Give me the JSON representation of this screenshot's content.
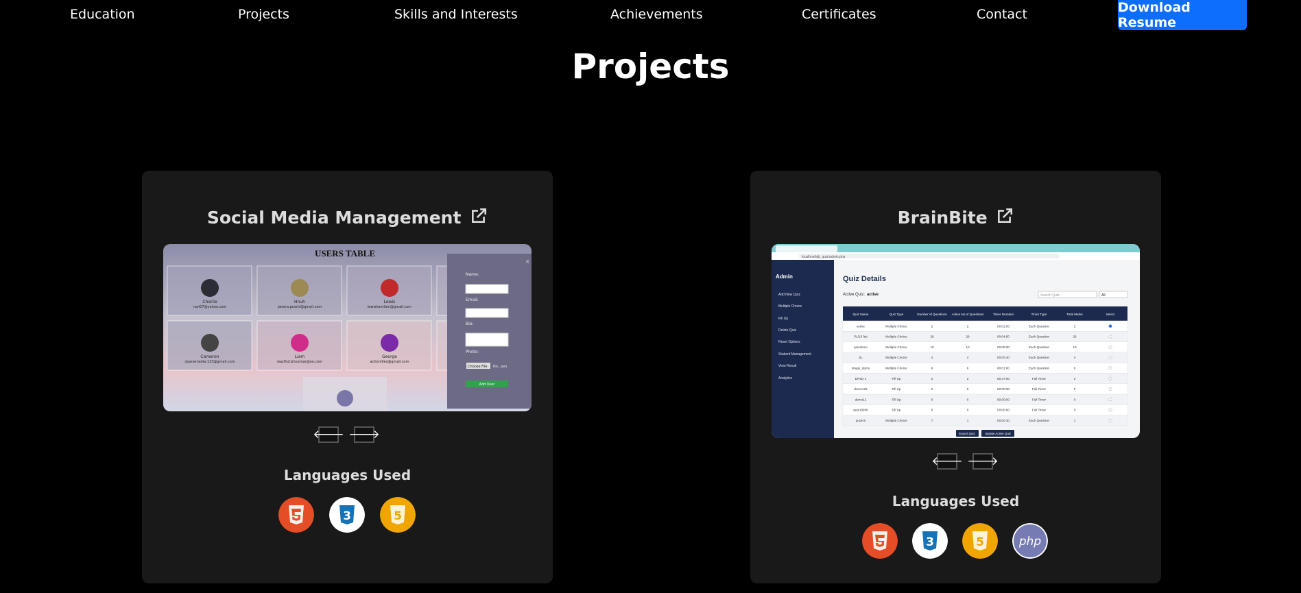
{
  "nav": {
    "items": [
      "Education",
      "Projects",
      "Skills and Interests",
      "Achievements",
      "Certificates",
      "Contact"
    ],
    "resume_label": "Download Resume"
  },
  "page_title": "Projects",
  "projects": [
    {
      "title": "Social Media Management",
      "languages_heading": "Languages Used",
      "languages": [
        "html5-icon",
        "css3-icon",
        "javascript-icon"
      ],
      "screenshot": {
        "heading": "USERS TABLE",
        "form_labels": [
          "Name:",
          "Email:",
          "Bio:",
          "Photo:"
        ],
        "file_button": "Choose File",
        "file_text": "No...sen",
        "submit": "Add User",
        "users": [
          {
            "name": "Charlie",
            "email": "ravi07@yahoo.com"
          },
          {
            "name": "Hnuh",
            "email": "perera.prashi@gmail.com"
          },
          {
            "name": "Lewis",
            "email": "lewishamiton@gmail.com"
          },
          {
            "name": "Cameron",
            "email": "dyanameola.123@gmail.com"
          },
          {
            "name": "Liam",
            "email": "wazifsd.bhoomar@oo.com"
          },
          {
            "name": "George",
            "email": "actiontiles@gmail.com"
          }
        ]
      }
    },
    {
      "title": "BrainBite",
      "languages_heading": "Languages Used",
      "languages": [
        "html5-icon",
        "css3-icon",
        "javascript-icon",
        "php-icon"
      ],
      "screenshot": {
        "url": "localhost/qb_quiz/admin.php",
        "sidebar_title": "Admin",
        "sidebar_items": [
          "Add New Quiz",
          "Multiple Choice",
          "Fill Up",
          "Delete Quiz",
          "Reset Options",
          "Student Management",
          "View Result",
          "Analytics"
        ],
        "main_title": "Quiz Details",
        "active_label": "Active Quiz:",
        "active_value": "active",
        "search_placeholder": "Search Quiz...",
        "filter_value": "All",
        "columns": [
          "Quiz Name",
          "Quiz Type",
          "Number of Questions",
          "Active No.of Questions",
          "Timer Duration",
          "Timer Type",
          "Total Marks",
          "Select"
        ],
        "rows": [
          [
            "active",
            "Multiple Choice",
            "2",
            "2",
            "00:01:00",
            "Each Question",
            "2"
          ],
          [
            "PL/13 feb",
            "Multiple Choice",
            "29",
            "29",
            "00:04:50",
            "Each Question",
            "29"
          ],
          [
            "quizdemo",
            "Multiple Choice",
            "10",
            "10",
            "00:05:00",
            "Each Question",
            "10"
          ],
          [
            "SL",
            "Multiple Choice",
            "4",
            "4",
            "00:00:40",
            "Each Question",
            "4"
          ],
          [
            "image_demo",
            "Multiple Choice",
            "6",
            "6",
            "00:01:00",
            "Each Question",
            "6"
          ],
          [
            "DPSD 4",
            "Fill Up",
            "2",
            "2",
            "00:47:00",
            "Full Timer",
            "2"
          ],
          [
            "demo123",
            "Fill Up",
            "0",
            "0",
            "00:00:00",
            "Full Timer",
            "0"
          ],
          [
            "demo12",
            "Fill Up",
            "0",
            "0",
            "00:00:00",
            "Full Timer",
            "0"
          ],
          [
            "quiz19099",
            "Fill Up",
            "0",
            "0",
            "00:00:00",
            "Full Timer",
            "0"
          ],
          [
            "quizKS",
            "Multiple Choice",
            "7",
            "1",
            "00:00:30",
            "Each Question",
            "1"
          ]
        ],
        "btn_export": "Export Quiz",
        "btn_update": "Update Active Quiz"
      }
    }
  ],
  "colors": {
    "accent": "#0d6efd",
    "card_bg": "#191919",
    "html5": "#e44d26",
    "css3": "#1572b6",
    "js": "#f0a500",
    "php": "#777bb3",
    "admin_sidebar": "#1b2a4e"
  }
}
